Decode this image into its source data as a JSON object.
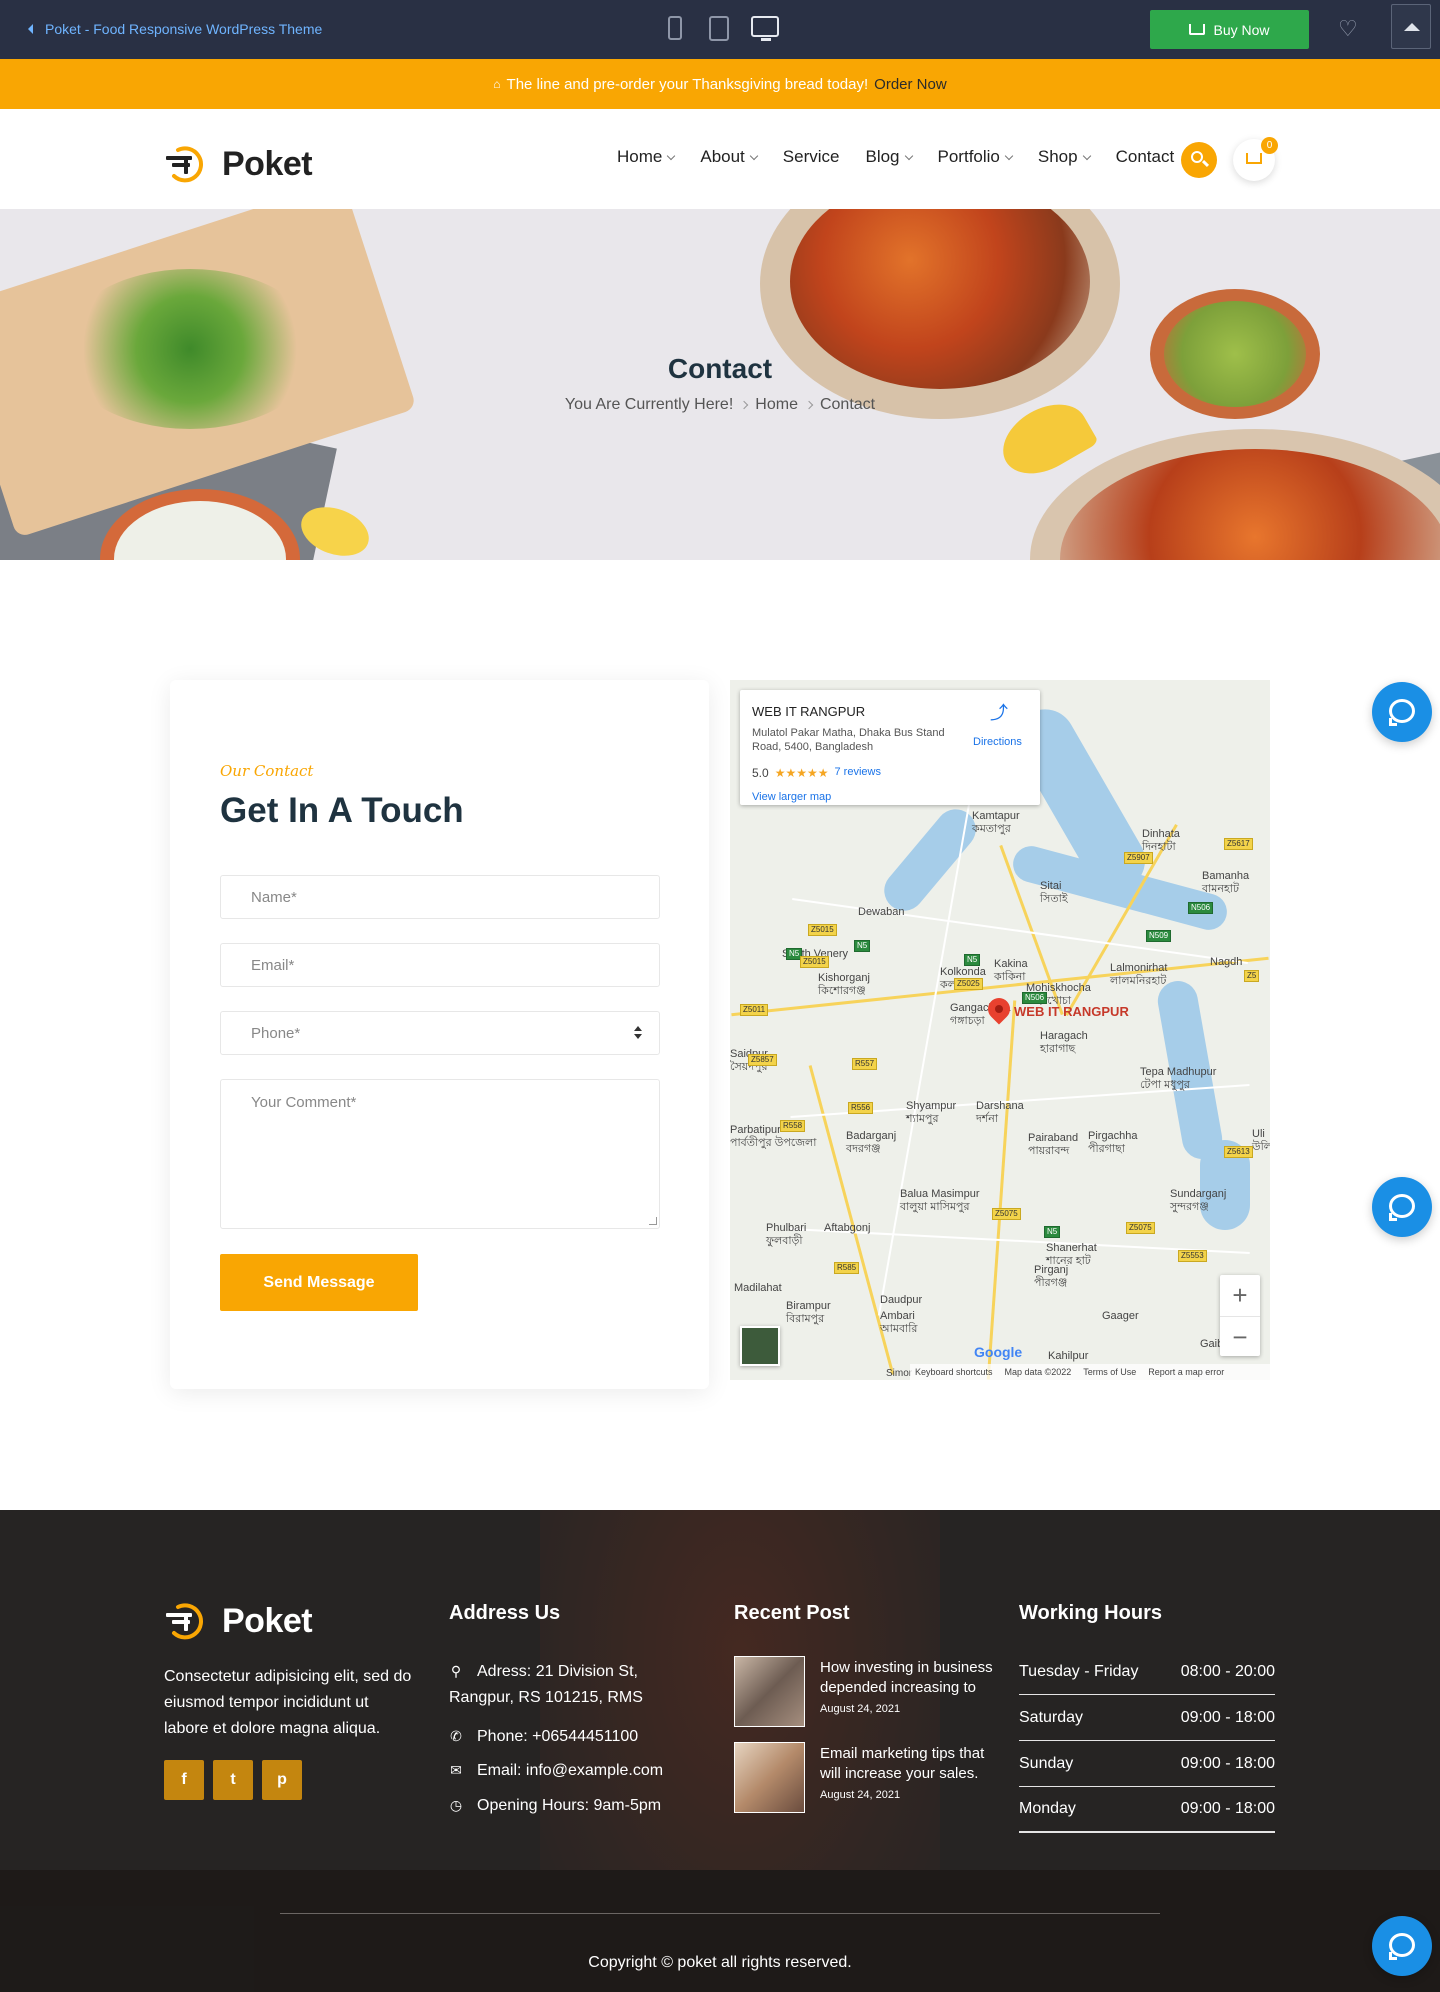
{
  "preview": {
    "back_label": "Poket - Food Responsive WordPress Theme",
    "buy_label": "Buy Now"
  },
  "notice": {
    "text": "The line and pre-order your Thanksgiving bread today!",
    "link": "Order Now"
  },
  "header": {
    "logo_text": "Poket",
    "nav": [
      {
        "label": "Home",
        "dropdown": true
      },
      {
        "label": "About",
        "dropdown": true
      },
      {
        "label": "Service",
        "dropdown": false
      },
      {
        "label": "Blog",
        "dropdown": true
      },
      {
        "label": "Portfolio",
        "dropdown": true
      },
      {
        "label": "Shop",
        "dropdown": true
      },
      {
        "label": "Contact",
        "dropdown": false
      }
    ],
    "cart_count": "0"
  },
  "hero": {
    "title": "Contact",
    "breadcrumb_prefix": "You Are Currently Here!",
    "breadcrumb_home": "Home",
    "breadcrumb_current": "Contact"
  },
  "contact": {
    "eyebrow": "Our Contact",
    "title": "Get In A Touch",
    "name_placeholder": "Name*",
    "email_placeholder": "Email*",
    "phone_placeholder": "Phone*",
    "comment_placeholder": "Your Comment*",
    "send_label": "Send Message"
  },
  "map": {
    "place_name": "WEB IT RANGPUR",
    "address": "Mulatol Pakar Matha, Dhaka Bus Stand Road, 5400, Bangladesh",
    "rating": "5.0",
    "stars": "★★★★★",
    "reviews": "7 reviews",
    "larger_map": "View larger map",
    "directions": "Directions",
    "pin_label": "WEB IT RANGPUR",
    "google": "Google",
    "footer_items": [
      "Keyboard shortcuts",
      "Map data ©2022",
      "Terms of Use",
      "Report a map error"
    ],
    "footer_left": "Simor",
    "labels": [
      {
        "text": "Kamtapur",
        "sub": "কমতাপুর"
      },
      {
        "text": "Dinhata",
        "sub": "দিনহাটা"
      },
      {
        "text": "Bamanha",
        "sub": "বামনহাট"
      },
      {
        "text": "Sitai",
        "sub": "সিতাই"
      },
      {
        "text": "Dewaban",
        "sub": ""
      },
      {
        "text": "Nagdh",
        "sub": ""
      },
      {
        "text": "South Venery",
        "sub": ""
      },
      {
        "text": "Kishorganj",
        "sub": "কিশোরগঞ্জ"
      },
      {
        "text": "Kakina",
        "sub": "কাকিনা"
      },
      {
        "text": "Kolkonda",
        "sub": "কলকন্দা"
      },
      {
        "text": "Lalmonirhat",
        "sub": "লালমনিরহাট"
      },
      {
        "text": "Mohiskhocha",
        "sub": "মহিষখোচা"
      },
      {
        "text": "Gangachara",
        "sub": "গঙ্গাচড়া"
      },
      {
        "text": "Haragach",
        "sub": "হারাগাছ"
      },
      {
        "text": "Saidpur",
        "sub": "সৈয়দপুর"
      },
      {
        "text": "Tepa Madhupur",
        "sub": "টেপা মধুপুর"
      },
      {
        "text": "Shyampur",
        "sub": "শ্যামপুর"
      },
      {
        "text": "Darshana",
        "sub": "দর্শনা"
      },
      {
        "text": "Parbatipur",
        "sub": "পার্বতীপুর উপজেলা"
      },
      {
        "text": "Badarganj",
        "sub": "বদরগঞ্জ"
      },
      {
        "text": "Pairaband",
        "sub": "পায়রাবন্দ"
      },
      {
        "text": "Pirgachha",
        "sub": "পীরগাছা"
      },
      {
        "text": "Uli",
        "sub": "উলি"
      },
      {
        "text": "Sundarganj",
        "sub": "সুন্দরগঞ্জ"
      },
      {
        "text": "Balua Masimpur",
        "sub": "বালুয়া মাসিমপুর"
      },
      {
        "text": "Aftabgonj",
        "sub": ""
      },
      {
        "text": "Phulbari",
        "sub": "ফুলবাড়ী"
      },
      {
        "text": "Shanerhat",
        "sub": "শানের হাট"
      },
      {
        "text": "Madilahat",
        "sub": ""
      },
      {
        "text": "Pirganj",
        "sub": "পীরগঞ্জ"
      },
      {
        "text": "Birampur",
        "sub": "বিরামপুর"
      },
      {
        "text": "Daudpur",
        "sub": ""
      },
      {
        "text": "Ambari",
        "sub": "আমবারি"
      },
      {
        "text": "Gaager",
        "sub": ""
      },
      {
        "text": "Gaibandha",
        "sub": ""
      },
      {
        "text": "Kahilpur",
        "sub": ""
      }
    ],
    "pills": [
      {
        "text": "Z5617",
        "green": false
      },
      {
        "text": "Z5907",
        "green": false
      },
      {
        "text": "N506",
        "green": true
      },
      {
        "text": "N509",
        "green": true
      },
      {
        "text": "Z5015",
        "green": false
      },
      {
        "text": "N5",
        "green": true
      },
      {
        "text": "Z5015",
        "green": false
      },
      {
        "text": "N5",
        "green": true
      },
      {
        "text": "N5",
        "green": true
      },
      {
        "text": "Z5025",
        "green": false
      },
      {
        "text": "N506",
        "green": true
      },
      {
        "text": "Z5011",
        "green": false
      },
      {
        "text": "Z5857",
        "green": false
      },
      {
        "text": "R557",
        "green": false
      },
      {
        "text": "R556",
        "green": false
      },
      {
        "text": "R558",
        "green": false
      },
      {
        "text": "Z5613",
        "green": false
      },
      {
        "text": "Z5075",
        "green": false
      },
      {
        "text": "N5",
        "green": true
      },
      {
        "text": "Z5075",
        "green": false
      },
      {
        "text": "Z5553",
        "green": false
      },
      {
        "text": "R585",
        "green": false
      },
      {
        "text": "Z5",
        "green": false
      }
    ]
  },
  "footer": {
    "logo_text": "Poket",
    "about": "Consectetur adipisicing elit, sed do eiusmod tempor incididunt ut labore et dolore magna aliqua.",
    "social": [
      "f",
      "t",
      "p"
    ],
    "address_heading": "Address Us",
    "address": "Adress: 21 Division St, Rangpur, RS 101215, RMS",
    "phone": "Phone: +06544451100",
    "email": "Email: info@example.com",
    "opening": "Opening Hours: 9am-5pm",
    "posts_heading": "Recent Post",
    "posts": [
      {
        "title": "How investing in business depended increasing to",
        "date": "August 24, 2021"
      },
      {
        "title": "Email marketing tips that will increase your sales.",
        "date": "August 24, 2021"
      }
    ],
    "hours_heading": "Working Hours",
    "hours": [
      {
        "day": "Tuesday - Friday",
        "time": "08:00 - 20:00"
      },
      {
        "day": "Saturday",
        "time": "09:00 - 18:00"
      },
      {
        "day": "Sunday",
        "time": "09:00 - 18:00"
      },
      {
        "day": "Monday",
        "time": "09:00 - 18:00"
      }
    ],
    "copyright": "Copyright © poket all rights reserved."
  },
  "colors": {
    "accent": "#f9a603",
    "preview_bar": "#293044",
    "buy_button": "#2ea84b",
    "title_dark": "#1f3340",
    "chat_blue": "#1a8fe5"
  }
}
